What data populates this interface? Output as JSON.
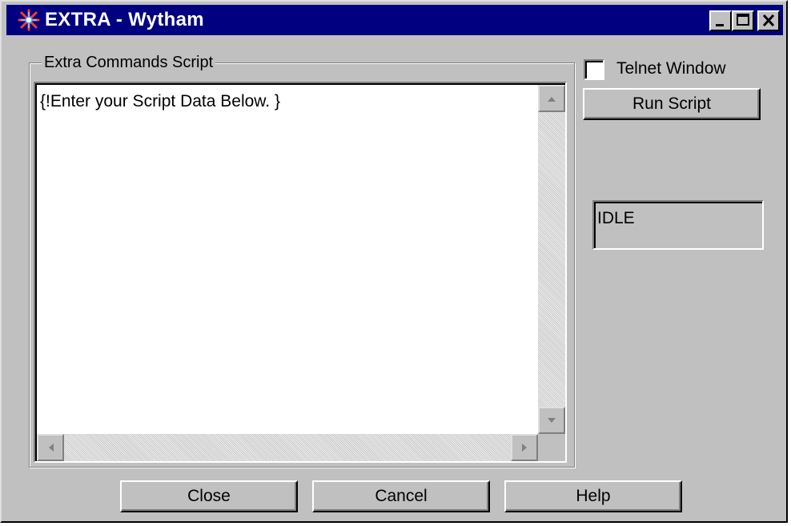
{
  "window": {
    "title": "EXTRA - Wytham",
    "title_bar_color": "#000080",
    "face_color": "#c0c0c0",
    "caption_buttons": [
      "minimize-icon",
      "maximize-icon",
      "close-icon"
    ]
  },
  "script_group": {
    "label": "Extra Commands Script",
    "content": "{!Enter your Script Data Below. }"
  },
  "telnet": {
    "label": "Telnet Window",
    "checked": false
  },
  "run_button": {
    "label": "Run Script"
  },
  "status": {
    "text": "IDLE"
  },
  "footer": {
    "close_label": "Close",
    "cancel_label": "Cancel",
    "help_label": "Help"
  }
}
